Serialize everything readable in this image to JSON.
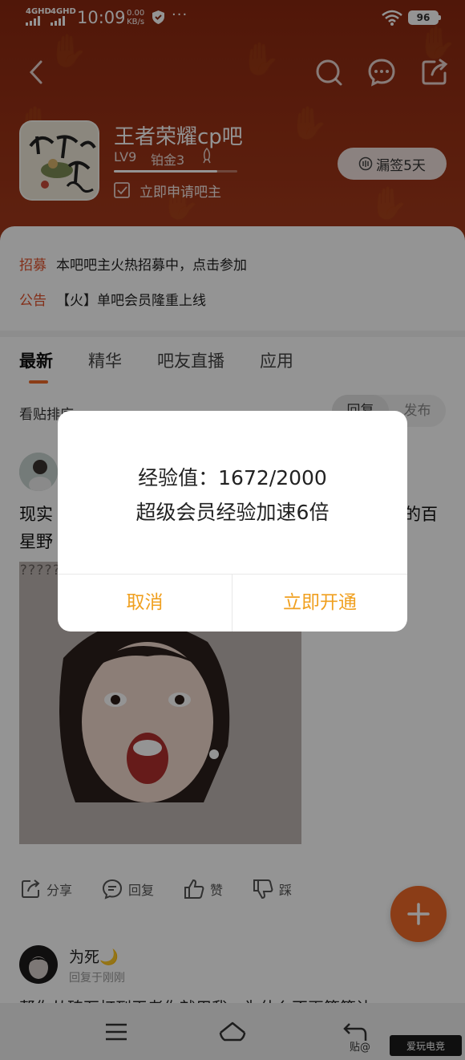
{
  "status_bar": {
    "network1": "4GHD",
    "network2": "4GHD",
    "time": "10:09",
    "speed_value": "0.00",
    "speed_unit": "KB/s",
    "more": "···",
    "battery": "96"
  },
  "forum": {
    "name": "王者荣耀cp吧",
    "level": "LV9",
    "rank": "铂金3",
    "level_progress": 0.836,
    "apply_label": "立即申请吧主",
    "signin_label": "漏签5天"
  },
  "notices": [
    {
      "tag": "招募",
      "text": "本吧吧主火热招募中，点击参加"
    },
    {
      "tag": "公告",
      "text": "【火】单吧会员隆重上线"
    }
  ],
  "tabs": [
    {
      "label": "最新",
      "active": true
    },
    {
      "label": "精华",
      "active": false
    },
    {
      "label": "吧友直播",
      "active": false
    },
    {
      "label": "应用",
      "active": false
    }
  ],
  "sort": {
    "label": "看贴排序",
    "options": [
      "回复",
      "发布"
    ],
    "selected": "回复"
  },
  "post": {
    "text_line1_start": "现实",
    "text_line1_end": "的百",
    "text_line2": "星野",
    "image_text": "??????????????????????????????????????????????????????????????????????????????????????????????????????????????????????????????????????????????????????????????????????????????????????????????????????????????????????????????????????????????????????????????????????????????????????????????????????????????????????????????????????????????????????????????????????????????????????????????????????????????????????????????????????????????????????????????"
  },
  "actions": [
    {
      "label": "分享",
      "icon": "share-icon"
    },
    {
      "label": "回复",
      "icon": "comment-icon"
    },
    {
      "label": "赞",
      "icon": "thumbs-up-icon"
    },
    {
      "label": "踩",
      "icon": "thumbs-down-icon"
    }
  ],
  "reply": {
    "name": "为死🌙",
    "sub": "回复于刚刚",
    "preview": "帮你从砖石打到王者你就用我，为什么不再等等让"
  },
  "bottom": {
    "tie_tag": "贴@",
    "watermark": "爱玩电竞"
  },
  "dialog": {
    "line1": "经验值：1672/2000",
    "line2": "超级会员经验加速6倍",
    "cancel": "取消",
    "confirm": "立即开通"
  },
  "colors": {
    "accent": "#f06a28",
    "dialog_button": "#f0a020",
    "notice_tag": "#e2512b",
    "header": "#9a3216"
  }
}
